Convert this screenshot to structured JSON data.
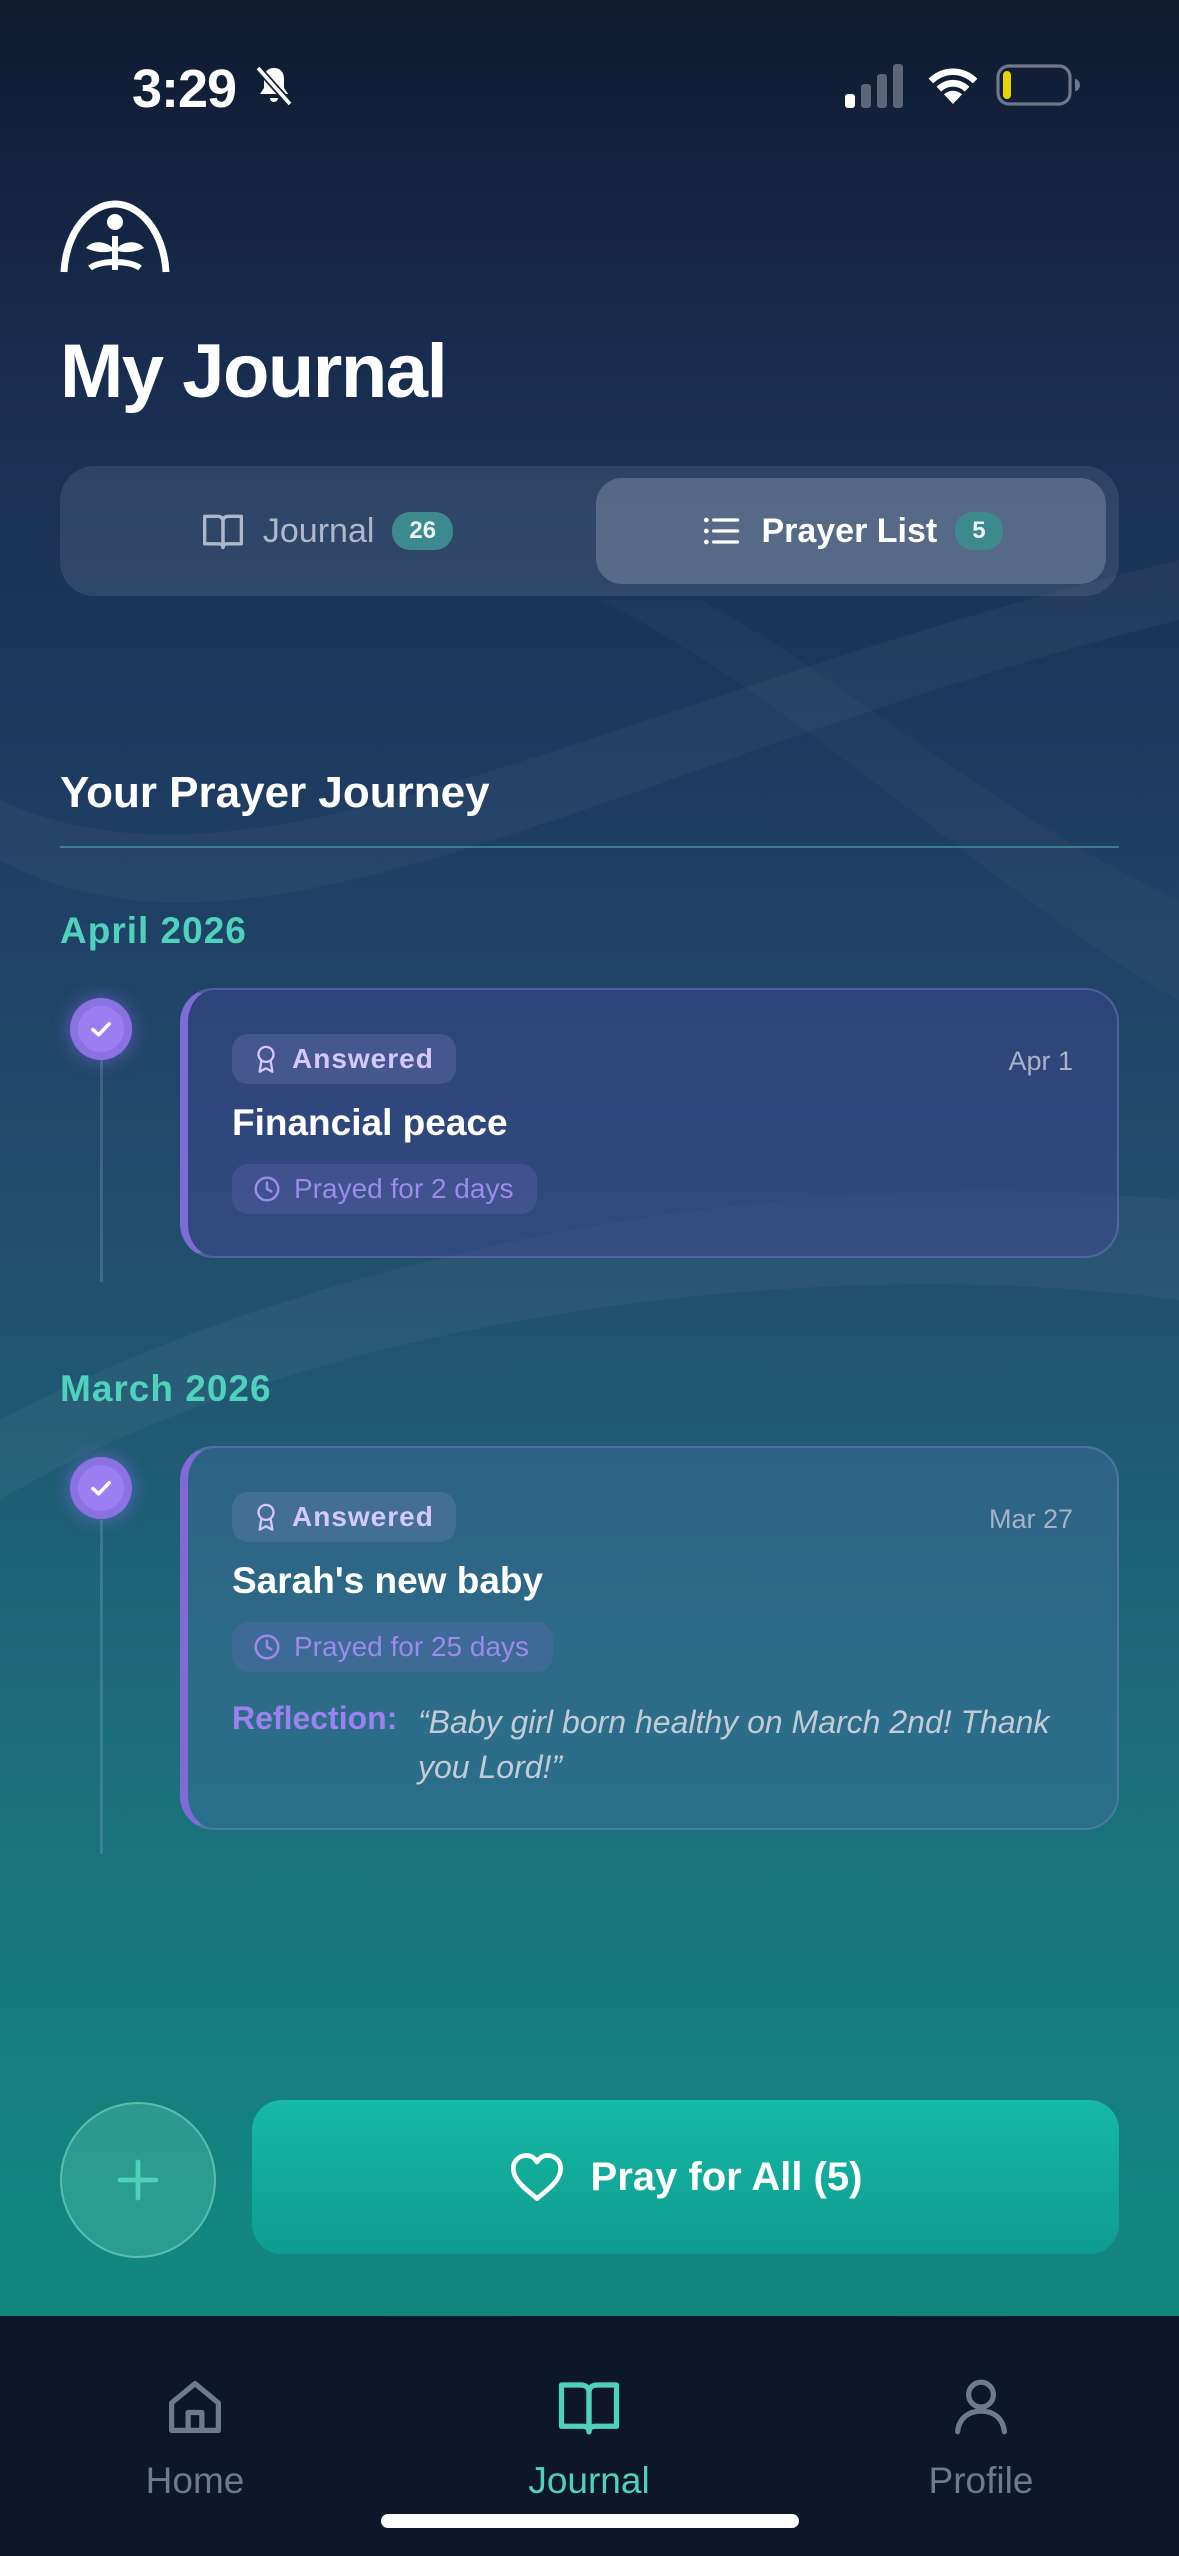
{
  "status_bar": {
    "time": "3:29",
    "icons": [
      "bell-slash-icon",
      "cellular-signal-icon",
      "wifi-icon",
      "battery-low-icon"
    ],
    "battery_color": "#e8d400"
  },
  "header": {
    "logo_icon": "sprout-arch-logo",
    "title": "My Journal"
  },
  "tabs": [
    {
      "label": "Journal",
      "count": "26",
      "icon": "book-open-icon",
      "selected": false
    },
    {
      "label": "Prayer List",
      "count": "5",
      "icon": "list-icon",
      "selected": true
    }
  ],
  "section": {
    "title": "Your Prayer Journey"
  },
  "groups": [
    {
      "month": "April 2026",
      "entries": [
        {
          "status": "Answered",
          "date": "Apr 1",
          "title": "Financial peace",
          "prayed": "Prayed for 2 days"
        }
      ]
    },
    {
      "month": "March 2026",
      "entries": [
        {
          "status": "Answered",
          "date": "Mar 27",
          "title": "Sarah's new baby",
          "prayed": "Prayed for 25 days",
          "reflection_label": "Reflection:",
          "reflection": "“Baby girl born healthy on March 2nd! Thank you Lord!”"
        }
      ]
    }
  ],
  "actions": {
    "add_icon": "plus-icon",
    "pray_all_label": "Pray for All (5)",
    "pray_all_icon": "heart-icon"
  },
  "nav": [
    {
      "label": "Home",
      "icon": "home-icon",
      "active": false
    },
    {
      "label": "Journal",
      "icon": "book-open-icon",
      "active": true
    },
    {
      "label": "Profile",
      "icon": "person-icon",
      "active": false
    }
  ],
  "colors": {
    "accent": "#4fd1bd",
    "answered_purple": "#9b7ef0",
    "pray_button": "#16b8a6",
    "nav_background": "#0e1729"
  }
}
